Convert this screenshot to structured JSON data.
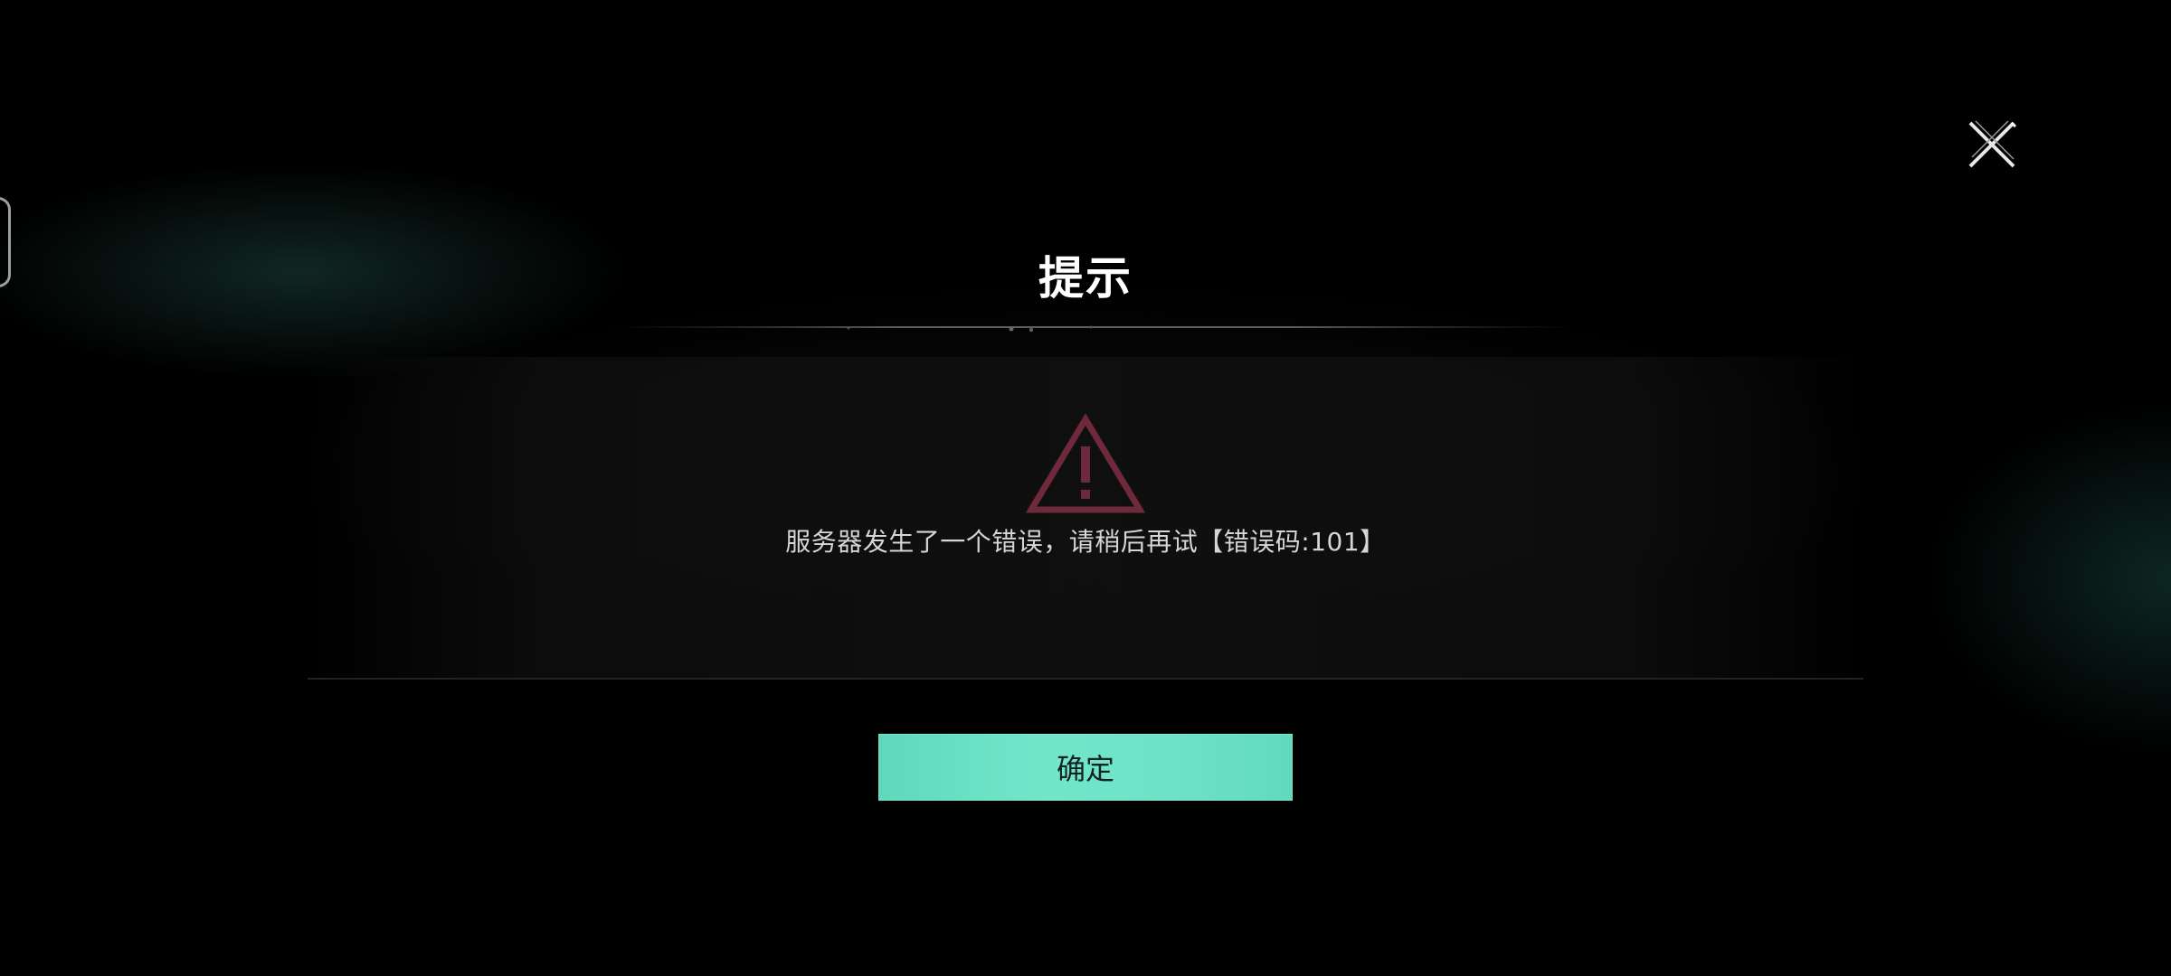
{
  "dialog": {
    "title": "提示",
    "message": "服务器发生了一个错误，请稍后再试【错误码:101】",
    "confirm_label": "确定"
  },
  "icons": {
    "close": "close-icon",
    "warning": "warning-triangle-icon"
  },
  "colors": {
    "background": "#000000",
    "accent": "#6ee2c8",
    "warning": "#6e2a3c",
    "title_text": "#ffffff",
    "message_text": "#d6d6d6"
  }
}
